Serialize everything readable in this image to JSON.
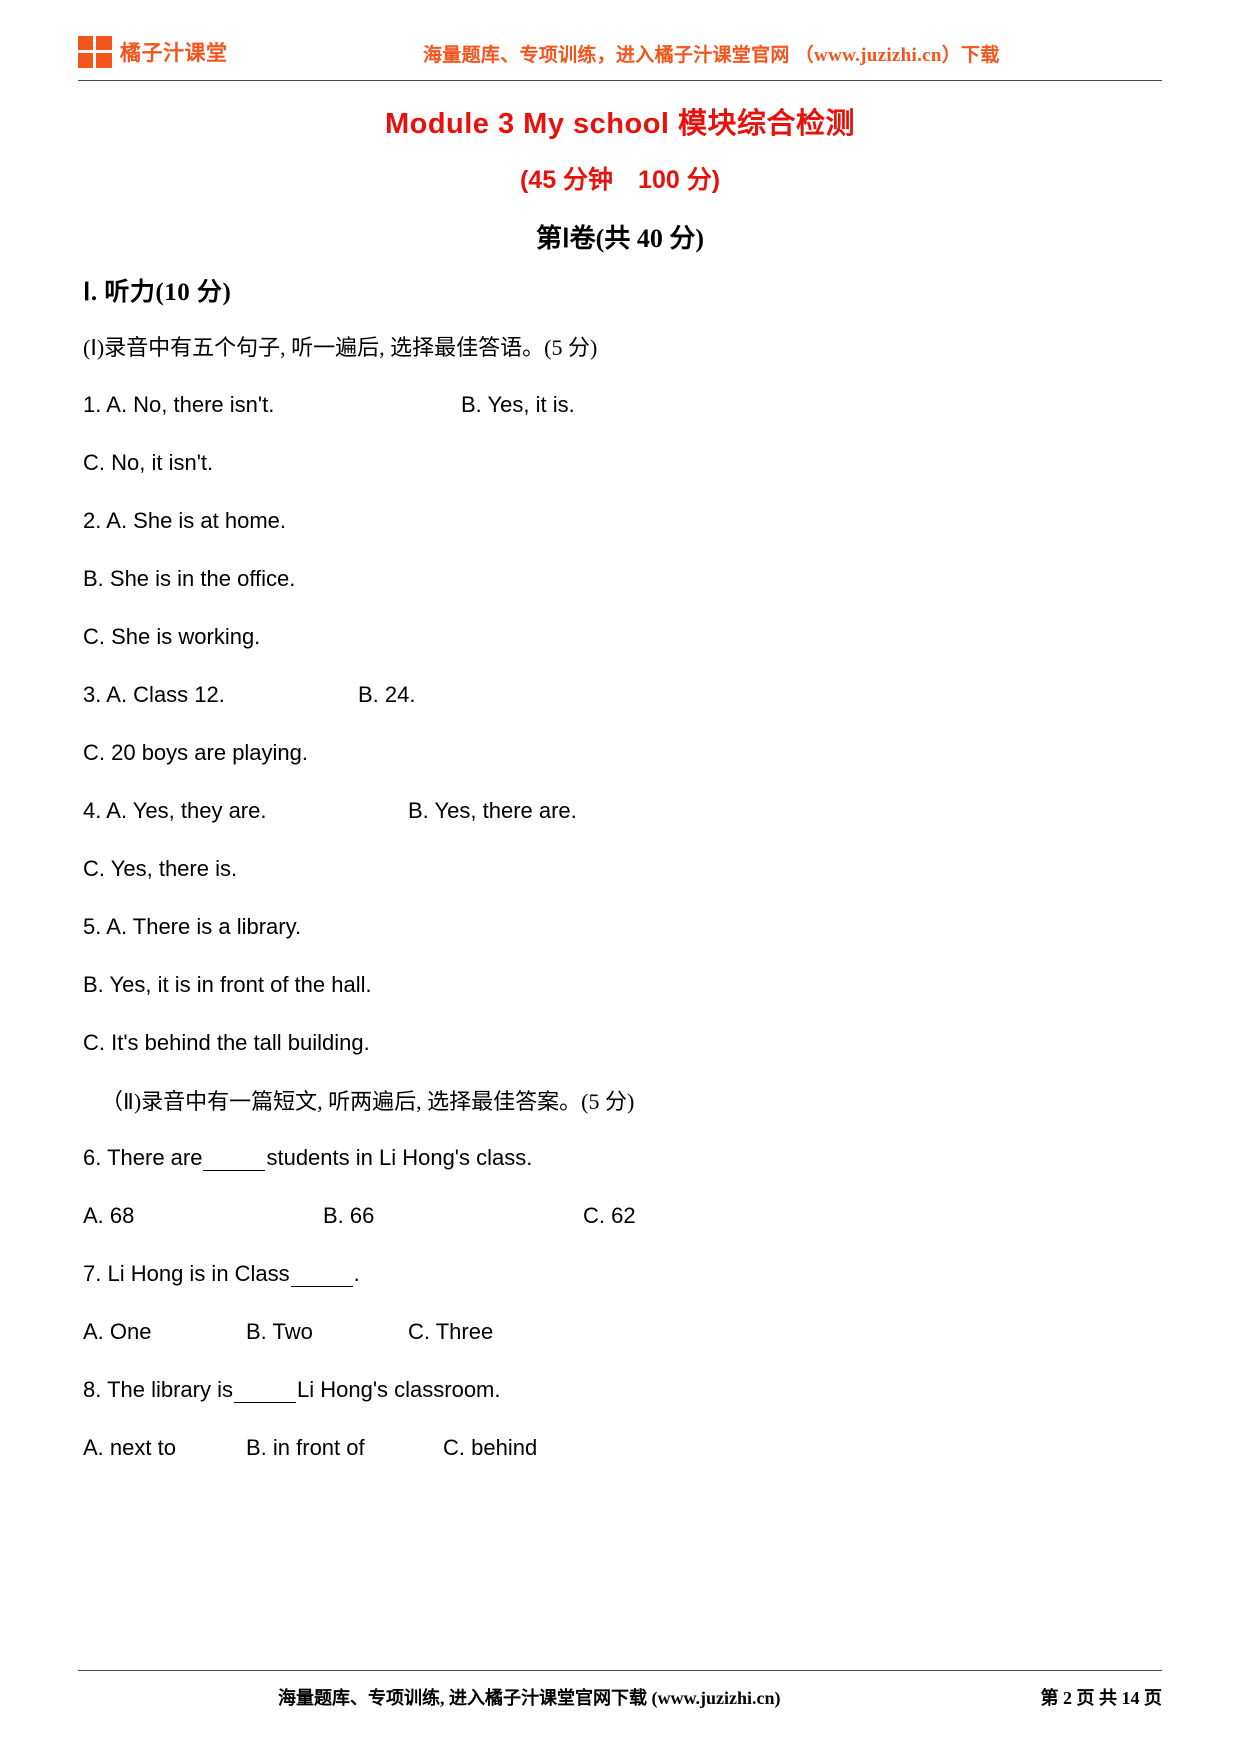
{
  "header": {
    "brand_name": "橘子汁课堂",
    "logo_icon": "four-square-logo-icon",
    "slogan": "海量题库、专项训练，进入橘子汁课堂官网 （www.juzizhi.cn）下载",
    "brand_color": "#f4551d"
  },
  "title": {
    "main": "Module 3 My school 模块综合检测",
    "subtitle": "(45 分钟　100 分)",
    "part": "第Ⅰ卷(共 40 分)",
    "color": "#e8120c"
  },
  "sections": [
    {
      "heading": "Ⅰ. 听力(10 分)",
      "instruction_1": "(Ⅰ)录音中有五个句子, 听一遍后, 选择最佳答语。(5 分)",
      "instruction_2": "（Ⅱ)录音中有一篇短文, 听两遍后, 选择最佳答案。(5 分)"
    }
  ],
  "questions": [
    {
      "num": "1.",
      "stem": "A. No, there isn't.",
      "opt_b": "B. Yes, it is.",
      "opt_c": "C. No, it isn't."
    },
    {
      "num": "2.",
      "stem": "A. She is at home.",
      "opt_b": "B. She is in the office.",
      "opt_c": "C. She is working."
    },
    {
      "num": "3.",
      "stem": "A. Class 12.",
      "opt_b": "B. 24.",
      "opt_c": "C. 20 boys are playing."
    },
    {
      "num": "4.",
      "stem": "A. Yes, they are.",
      "opt_b": "B. Yes, there are.",
      "opt_c": "C. Yes, there is."
    },
    {
      "num": "5.",
      "stem": "A. There is a library.",
      "opt_b": "B. Yes, it is in front of the hall.",
      "opt_c": "C. It's behind the tall building."
    }
  ],
  "passage_questions": [
    {
      "num": "6.",
      "stem_before": "There are",
      "stem_after": "students in Li Hong's class.",
      "a": "A. 68",
      "b": "B. 66",
      "c": "C. 62"
    },
    {
      "num": "7.",
      "stem_before": "Li Hong is in Class",
      "stem_after": ".",
      "a": "A. One",
      "b": "B. Two",
      "c": "C. Three"
    },
    {
      "num": "8.",
      "stem_before": "The library is",
      "stem_after": "Li Hong's classroom.",
      "a": "A. next to",
      "b": "B. in front of",
      "c": "C. behind"
    }
  ],
  "footer": {
    "center": "海量题库、专项训练, 进入橘子汁课堂官网下载 (www.juzizhi.cn)",
    "page": "第 2 页 共 14 页"
  }
}
